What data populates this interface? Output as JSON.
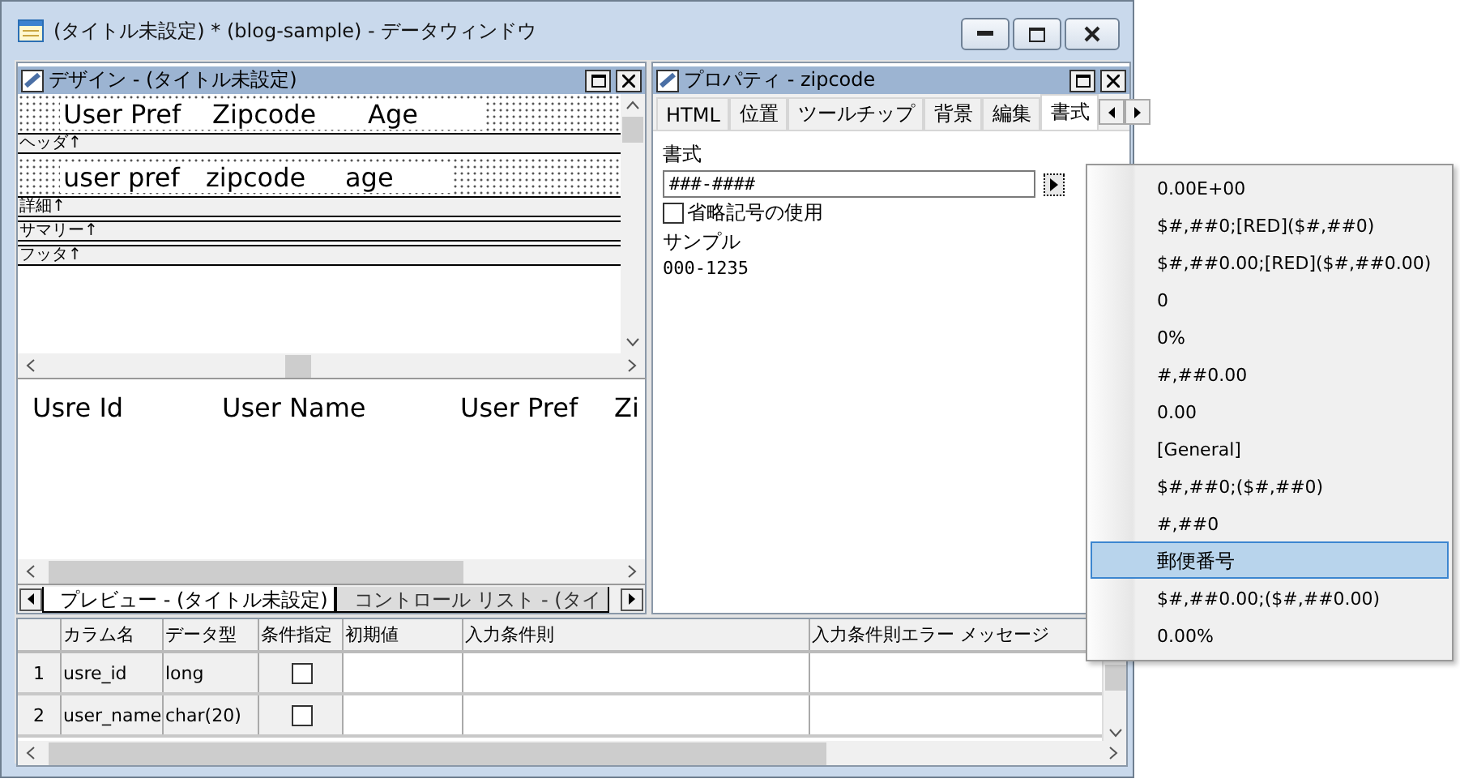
{
  "window": {
    "title": "(タイトル未設定) * (blog-sample) - データウィンドウ"
  },
  "design": {
    "title": "デザイン - (タイトル未設定)",
    "header_labels": [
      "User Pref",
      "Zipcode",
      "Age"
    ],
    "detail_fields": [
      "user pref",
      "zipcode",
      "age"
    ],
    "bands": [
      "ヘッダ↑",
      "詳細↑",
      "サマリー↑",
      "フッタ↑"
    ]
  },
  "preview": {
    "columns": [
      "Usre Id",
      "User Name",
      "User Pref",
      "Zi"
    ],
    "tabs": [
      {
        "label": "プレビュー - (タイトル未設定)",
        "selected": true
      },
      {
        "label": "コントロール リスト - (タイ",
        "selected": false
      }
    ]
  },
  "properties": {
    "title": "プロパティ - zipcode",
    "tabs": [
      {
        "label": "HTML",
        "selected": false
      },
      {
        "label": "位置",
        "selected": false
      },
      {
        "label": "ツールチップ",
        "selected": false
      },
      {
        "label": "背景",
        "selected": false
      },
      {
        "label": "編集",
        "selected": false
      },
      {
        "label": "書式",
        "selected": true
      }
    ],
    "format_label": "書式",
    "format_value": "###-####",
    "ellipsis_option": {
      "label": "省略記号の使用",
      "checked": false
    },
    "sample_label": "サンプル",
    "sample_value": "000-1235"
  },
  "format_menu": [
    {
      "label": "0.00E+00",
      "selected": false
    },
    {
      "label": "$#,##0;[RED]($#,##0)",
      "selected": false
    },
    {
      "label": "$#,##0.00;[RED]($#,##0.00)",
      "selected": false
    },
    {
      "label": "0",
      "selected": false
    },
    {
      "label": "0%",
      "selected": false
    },
    {
      "label": "#,##0.00",
      "selected": false
    },
    {
      "label": "0.00",
      "selected": false
    },
    {
      "label": "[General]",
      "selected": false
    },
    {
      "label": "$#,##0;($#,##0)",
      "selected": false
    },
    {
      "label": "#,##0",
      "selected": false
    },
    {
      "label": "郵便番号",
      "selected": true
    },
    {
      "label": "$#,##0.00;($#,##0.00)",
      "selected": false
    },
    {
      "label": "0.00%",
      "selected": false
    }
  ],
  "grid": {
    "columns": [
      "カラム名",
      "データ型",
      "条件指定",
      "初期値",
      "入力条件則",
      "入力条件則エラー メッセージ"
    ],
    "rows": [
      {
        "number": "1",
        "name": "usre_id",
        "type": "long",
        "condition": false
      },
      {
        "number": "2",
        "name": "user_name",
        "type": "char(20)",
        "condition": false
      }
    ]
  }
}
